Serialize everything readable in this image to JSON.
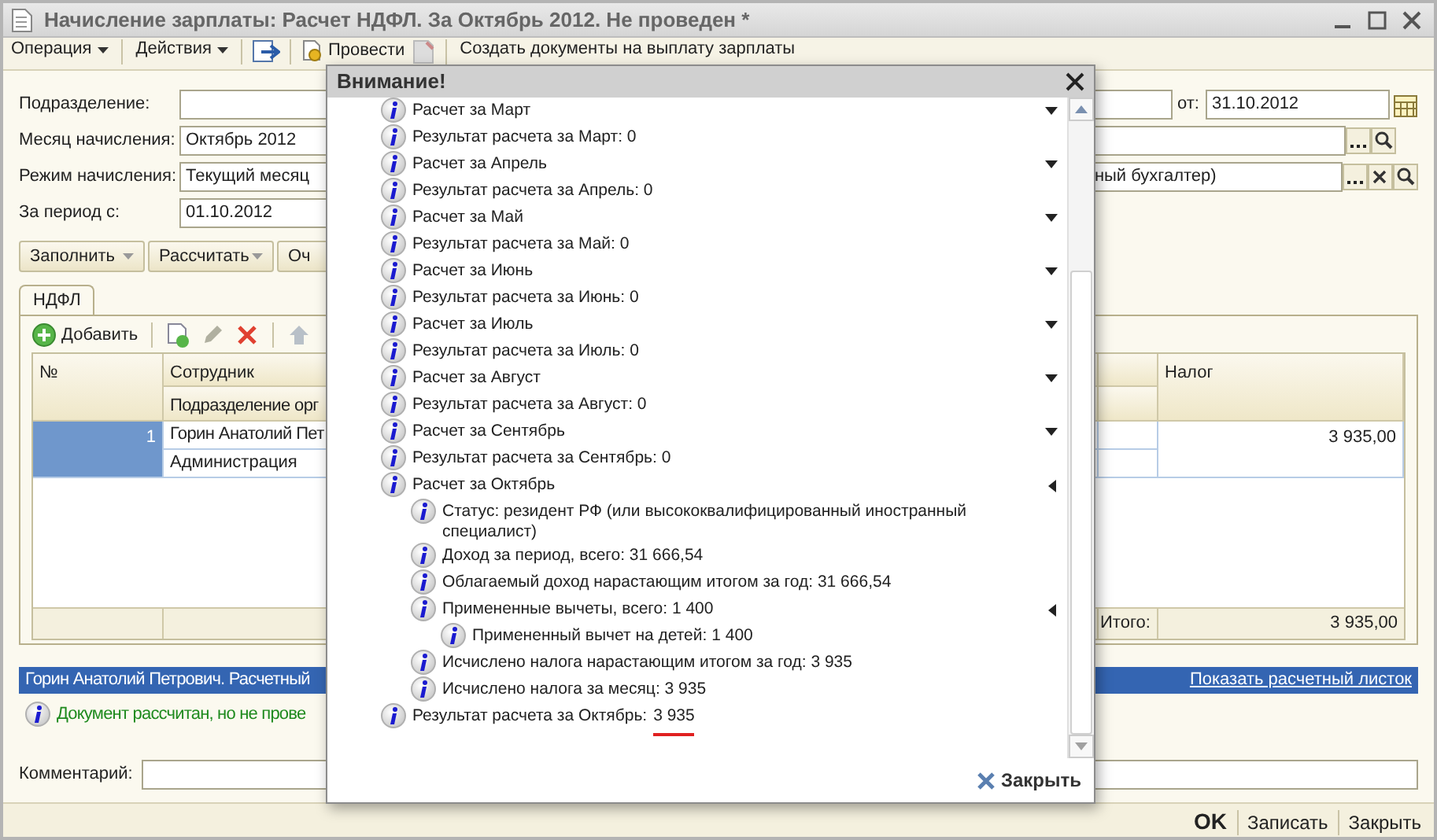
{
  "window": {
    "title": "Начисление зарплаты: Расчет НДФЛ. За Октябрь 2012. Не проведен *"
  },
  "toolbar": [
    {
      "label": "Операция",
      "kind": "menu"
    },
    {
      "label": "Действия",
      "kind": "menu"
    },
    {
      "label": "Провести",
      "kind": "post"
    },
    {
      "label": "Создать документы на выплату зарплаты",
      "kind": "plain"
    }
  ],
  "form": {
    "subdivision": {
      "label": "Подразделение:"
    },
    "date": {
      "label": "от:",
      "value": "31.10.2012"
    },
    "month": {
      "label": "Месяц начисления:",
      "value": "Октябрь 2012"
    },
    "mode": {
      "label": "Режим начисления:",
      "value": "Текущий месяц",
      "responsible": "ный бухгалтер)"
    },
    "period": {
      "label": "За период с:",
      "value": "01.10.2012"
    }
  },
  "actions": [
    {
      "label": "Заполнить",
      "dropdown": true
    },
    {
      "label": "Рассчитать",
      "dropdown": true
    },
    {
      "label": "Оч",
      "dropdown": false
    }
  ],
  "tabs": [
    {
      "label": "НДФЛ",
      "selected": true
    }
  ],
  "table_toolbar": {
    "add": "Добавить"
  },
  "table": {
    "columns": [
      {
        "label": "№"
      },
      {
        "label": "Сотрудник",
        "sub": "Подразделение орг"
      },
      {
        "label": "Налог"
      }
    ],
    "rows": [
      {
        "number": "1",
        "employee": "Горин Анатолий Пет",
        "department": "Администрация",
        "tax": "3 935,00",
        "selected": true
      }
    ],
    "footer": {
      "label": "Итого:",
      "value": "3 935,00"
    }
  },
  "detail_bar": {
    "text": "Горин Анатолий Петрович. Расчетный",
    "link": "Показать расчетный листок"
  },
  "message": "Документ рассчитан, но не прове",
  "comment": {
    "label": "Комментарий:"
  },
  "bottom_buttons": [
    {
      "label": "OK",
      "default": true
    },
    {
      "label": "Записать",
      "default": false
    },
    {
      "label": "Закрыть",
      "default": false
    }
  ],
  "dialog": {
    "title": "Внимание!",
    "close_button": "Закрыть",
    "items": [
      {
        "kind": "group",
        "text": "Расчет за Март",
        "expanded": false
      },
      {
        "kind": "message",
        "text": "Результат расчета за Март: 0"
      },
      {
        "kind": "group",
        "text": "Расчет за Апрель",
        "expanded": false
      },
      {
        "kind": "message",
        "text": "Результат расчета за Апрель: 0"
      },
      {
        "kind": "group",
        "text": "Расчет за Май",
        "expanded": false
      },
      {
        "kind": "message",
        "text": "Результат расчета за Май: 0"
      },
      {
        "kind": "group",
        "text": "Расчет за Июнь",
        "expanded": false
      },
      {
        "kind": "message",
        "text": "Результат расчета за Июнь: 0"
      },
      {
        "kind": "group",
        "text": "Расчет за Июль",
        "expanded": false
      },
      {
        "kind": "message",
        "text": "Результат расчета за Июль: 0"
      },
      {
        "kind": "group",
        "text": "Расчет за Август",
        "expanded": false
      },
      {
        "kind": "message",
        "text": "Результат расчета за Август: 0"
      },
      {
        "kind": "group",
        "text": "Расчет за Сентябрь",
        "expanded": false
      },
      {
        "kind": "message",
        "text": "Результат расчета за Сентябрь: 0"
      },
      {
        "kind": "group",
        "text": "Расчет за Октябрь",
        "expanded": true,
        "children": [
          {
            "kind": "message",
            "text": "Статус: резидент РФ (или высококвалифицированный иностранный специалист)"
          },
          {
            "kind": "message",
            "text": "Доход за период, всего: 31 666,54"
          },
          {
            "kind": "message",
            "text": "Облагаемый доход нарастающим итогом за год: 31 666,54"
          },
          {
            "kind": "group",
            "text": "Примененные вычеты, всего: 1 400",
            "expanded": true,
            "children": [
              {
                "kind": "message",
                "text": "Примененный вычет на детей: 1 400"
              }
            ]
          },
          {
            "kind": "message",
            "text": "Исчислено налога нарастающим итогом за год: 3 935"
          },
          {
            "kind": "message",
            "text": "Исчислено налога за месяц: 3 935"
          }
        ]
      },
      {
        "kind": "message",
        "text": "Результат расчета за Октябрь:",
        "value": "3 935",
        "marked": true
      }
    ]
  }
}
